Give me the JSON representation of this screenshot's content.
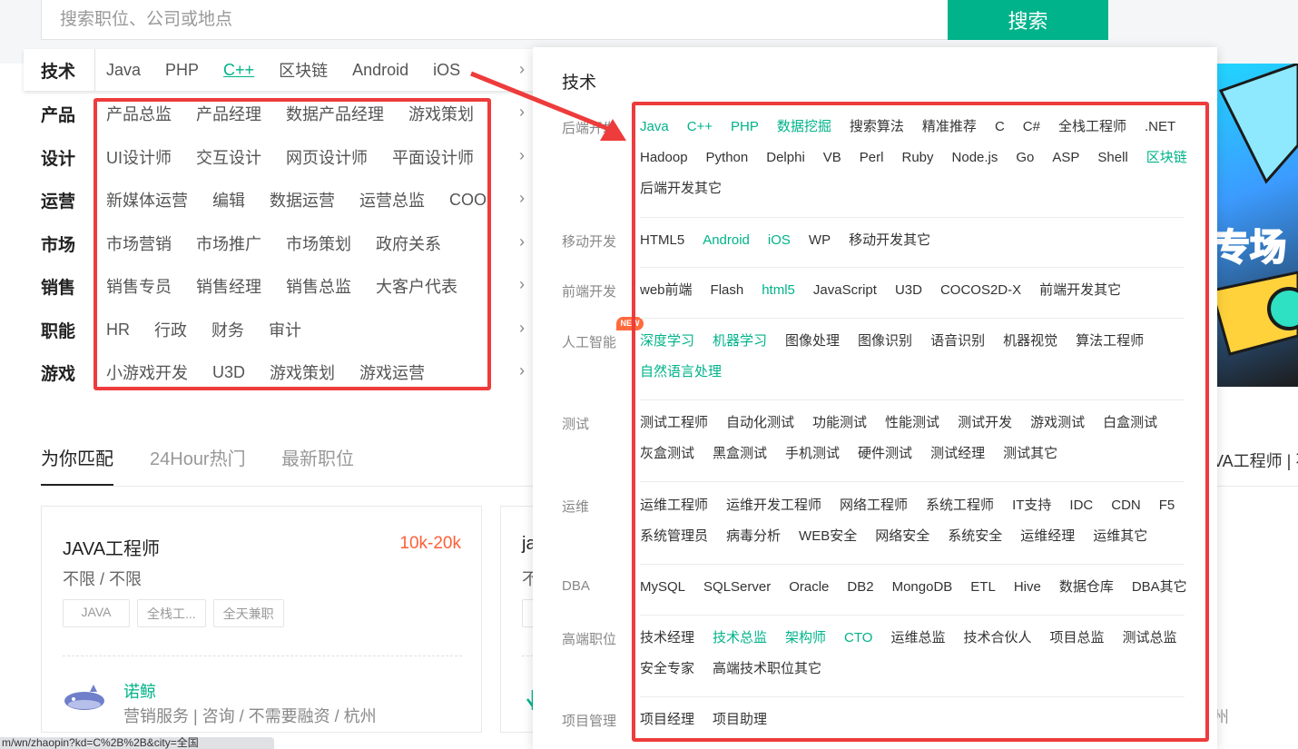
{
  "search": {
    "placeholder": "搜索职位、公司或地点",
    "button_label": "搜索"
  },
  "categories": [
    {
      "title": "技术",
      "items": [
        "Java",
        "PHP",
        "C++",
        "区块链",
        "Android",
        "iOS"
      ],
      "active_item": "C++"
    },
    {
      "title": "产品",
      "items": [
        "产品总监",
        "产品经理",
        "数据产品经理",
        "游戏策划"
      ]
    },
    {
      "title": "设计",
      "items": [
        "UI设计师",
        "交互设计",
        "网页设计师",
        "平面设计师"
      ]
    },
    {
      "title": "运营",
      "items": [
        "新媒体运营",
        "编辑",
        "数据运营",
        "运营总监",
        "COO"
      ]
    },
    {
      "title": "市场",
      "items": [
        "市场营销",
        "市场推广",
        "市场策划",
        "政府关系"
      ]
    },
    {
      "title": "销售",
      "items": [
        "销售专员",
        "销售经理",
        "销售总监",
        "大客户代表"
      ]
    },
    {
      "title": "职能",
      "items": [
        "HR",
        "行政",
        "财务",
        "审计"
      ]
    },
    {
      "title": "游戏",
      "items": [
        "小游戏开发",
        "U3D",
        "游戏策划",
        "游戏运营"
      ]
    }
  ],
  "arrow_glyph": "›",
  "tabs": [
    "为你匹配",
    "24Hour热门",
    "最新职位"
  ],
  "job_card": {
    "title": "JAVA工程师",
    "salary": "10k-20k",
    "requirements": "不限 / 不限",
    "tags": [
      "JAVA",
      "全栈工...",
      "全天兼职"
    ],
    "company_name": "诺鲸",
    "company_info": "营销服务 | 咨询 / 不需要融资 / 杭州"
  },
  "job_card_2": {
    "title": "ja",
    "requirements": "不"
  },
  "right_label": "VA工程师 | 不",
  "right_location": "州",
  "promo_text": "专场",
  "status_url": "m/wn/zhaopin?kd=C%2B%2B&city=全国",
  "mega": {
    "title": "技术",
    "new_badge": "NEW",
    "sections": [
      {
        "label": "后端开发",
        "items": [
          {
            "t": "Java",
            "hl": true
          },
          {
            "t": "C++",
            "hl": true
          },
          {
            "t": "PHP",
            "hl": true
          },
          {
            "t": "数据挖掘",
            "hl": true
          },
          {
            "t": "搜索算法"
          },
          {
            "t": "精准推荐"
          },
          {
            "t": "C"
          },
          {
            "t": "C#"
          },
          {
            "t": "全栈工程师"
          },
          {
            "t": ".NET"
          },
          {
            "t": "Hadoop"
          },
          {
            "t": "Python"
          },
          {
            "t": "Delphi"
          },
          {
            "t": "VB"
          },
          {
            "t": "Perl"
          },
          {
            "t": "Ruby"
          },
          {
            "t": "Node.js"
          },
          {
            "t": "Go"
          },
          {
            "t": "ASP"
          },
          {
            "t": "Shell"
          },
          {
            "t": "区块链",
            "hl": true
          },
          {
            "t": "后端开发其它"
          }
        ]
      },
      {
        "label": "移动开发",
        "items": [
          {
            "t": "HTML5"
          },
          {
            "t": "Android",
            "hl": true
          },
          {
            "t": "iOS",
            "hl": true
          },
          {
            "t": "WP"
          },
          {
            "t": "移动开发其它"
          }
        ]
      },
      {
        "label": "前端开发",
        "items": [
          {
            "t": "web前端"
          },
          {
            "t": "Flash"
          },
          {
            "t": "html5",
            "hl": true
          },
          {
            "t": "JavaScript"
          },
          {
            "t": "U3D"
          },
          {
            "t": "COCOS2D-X"
          },
          {
            "t": "前端开发其它"
          }
        ]
      },
      {
        "label": "人工智能",
        "items": [
          {
            "t": "深度学习",
            "hl": true
          },
          {
            "t": "机器学习",
            "hl": true
          },
          {
            "t": "图像处理"
          },
          {
            "t": "图像识别"
          },
          {
            "t": "语音识别"
          },
          {
            "t": "机器视觉"
          },
          {
            "t": "算法工程师"
          },
          {
            "t": "自然语言处理",
            "hl": true
          }
        ]
      },
      {
        "label": "测试",
        "items": [
          {
            "t": "测试工程师"
          },
          {
            "t": "自动化测试"
          },
          {
            "t": "功能测试"
          },
          {
            "t": "性能测试"
          },
          {
            "t": "测试开发"
          },
          {
            "t": "游戏测试"
          },
          {
            "t": "白盒测试"
          },
          {
            "t": "灰盒测试"
          },
          {
            "t": "黑盒测试"
          },
          {
            "t": "手机测试"
          },
          {
            "t": "硬件测试"
          },
          {
            "t": "测试经理"
          },
          {
            "t": "测试其它"
          }
        ]
      },
      {
        "label": "运维",
        "items": [
          {
            "t": "运维工程师"
          },
          {
            "t": "运维开发工程师"
          },
          {
            "t": "网络工程师"
          },
          {
            "t": "系统工程师"
          },
          {
            "t": "IT支持"
          },
          {
            "t": "IDC"
          },
          {
            "t": "CDN"
          },
          {
            "t": "F5"
          },
          {
            "t": "系统管理员"
          },
          {
            "t": "病毒分析"
          },
          {
            "t": "WEB安全"
          },
          {
            "t": "网络安全"
          },
          {
            "t": "系统安全"
          },
          {
            "t": "运维经理"
          },
          {
            "t": "运维其它"
          }
        ]
      },
      {
        "label": "DBA",
        "items": [
          {
            "t": "MySQL"
          },
          {
            "t": "SQLServer"
          },
          {
            "t": "Oracle"
          },
          {
            "t": "DB2"
          },
          {
            "t": "MongoDB"
          },
          {
            "t": "ETL"
          },
          {
            "t": "Hive"
          },
          {
            "t": "数据仓库"
          },
          {
            "t": "DBA其它"
          }
        ]
      },
      {
        "label": "高端职位",
        "items": [
          {
            "t": "技术经理"
          },
          {
            "t": "技术总监",
            "hl": true
          },
          {
            "t": "架构师",
            "hl": true
          },
          {
            "t": "CTO",
            "hl": true
          },
          {
            "t": "运维总监"
          },
          {
            "t": "技术合伙人"
          },
          {
            "t": "项目总监"
          },
          {
            "t": "测试总监"
          },
          {
            "t": "安全专家"
          },
          {
            "t": "高端技术职位其它"
          }
        ]
      },
      {
        "label": "项目管理",
        "items": [
          {
            "t": "项目经理"
          },
          {
            "t": "项目助理"
          }
        ]
      }
    ]
  },
  "colors": {
    "accent": "#00b38a",
    "salary": "#fd5f39",
    "annotation": "#ee3b3b"
  }
}
